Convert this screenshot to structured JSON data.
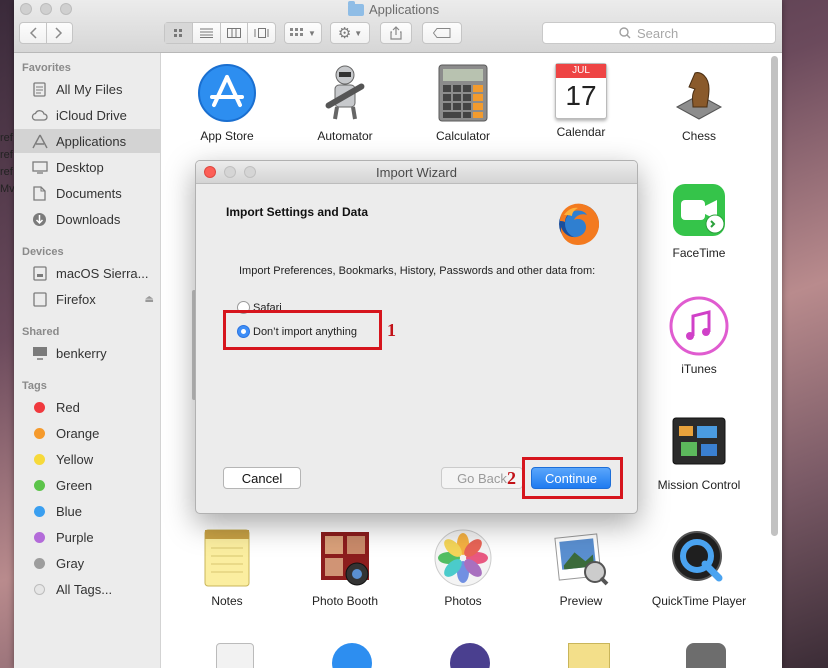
{
  "window": {
    "title": "Applications"
  },
  "desktop_sliver": [
    "ref",
    "ref",
    "ref",
    "Mv"
  ],
  "toolbar": {
    "search_placeholder": "Search"
  },
  "sidebar": {
    "favorites_header": "Favorites",
    "favorites": [
      {
        "label": "All My Files",
        "icon": "all-files-icon"
      },
      {
        "label": "iCloud Drive",
        "icon": "cloud-icon"
      },
      {
        "label": "Applications",
        "icon": "applications-icon",
        "selected": true
      },
      {
        "label": "Desktop",
        "icon": "desktop-icon"
      },
      {
        "label": "Documents",
        "icon": "document-icon"
      },
      {
        "label": "Downloads",
        "icon": "download-icon"
      }
    ],
    "devices_header": "Devices",
    "devices": [
      {
        "label": "macOS Sierra...",
        "icon": "disk-icon"
      },
      {
        "label": "Firefox",
        "icon": "disk-icon",
        "eject": true
      }
    ],
    "shared_header": "Shared",
    "shared": [
      {
        "label": "benkerry",
        "icon": "computer-icon"
      }
    ],
    "tags_header": "Tags",
    "tags": [
      {
        "label": "Red",
        "color": "#f0393e"
      },
      {
        "label": "Orange",
        "color": "#f59a2c"
      },
      {
        "label": "Yellow",
        "color": "#f6d93a"
      },
      {
        "label": "Green",
        "color": "#5cc44a"
      },
      {
        "label": "Blue",
        "color": "#3a9ff0"
      },
      {
        "label": "Purple",
        "color": "#b36bd9"
      },
      {
        "label": "Gray",
        "color": "#9d9d9d"
      },
      {
        "label": "All Tags...",
        "color": "#e6e6e6"
      }
    ]
  },
  "apps": {
    "row1": [
      "App Store",
      "Automator",
      "Calculator",
      "Calendar",
      "Chess"
    ],
    "right_col": [
      "FaceTime",
      "iTunes",
      "Mission Control"
    ],
    "row4": [
      "Notes",
      "Photo Booth",
      "Photos",
      "Preview",
      "QuickTime Player"
    ],
    "calendar_month": "JUL",
    "calendar_day": "17"
  },
  "dialog": {
    "title": "Import Wizard",
    "heading": "Import Settings and Data",
    "description": "Import Preferences, Bookmarks, History, Passwords and other data from:",
    "options": [
      {
        "label": "Safari",
        "selected": false
      },
      {
        "label": "Don’t import anything",
        "selected": true
      }
    ],
    "cancel_label": "Cancel",
    "goback_label": "Go Back",
    "continue_label": "Continue"
  },
  "annotations": {
    "label1": "1",
    "label2": "2",
    "color": "#d6151d"
  }
}
